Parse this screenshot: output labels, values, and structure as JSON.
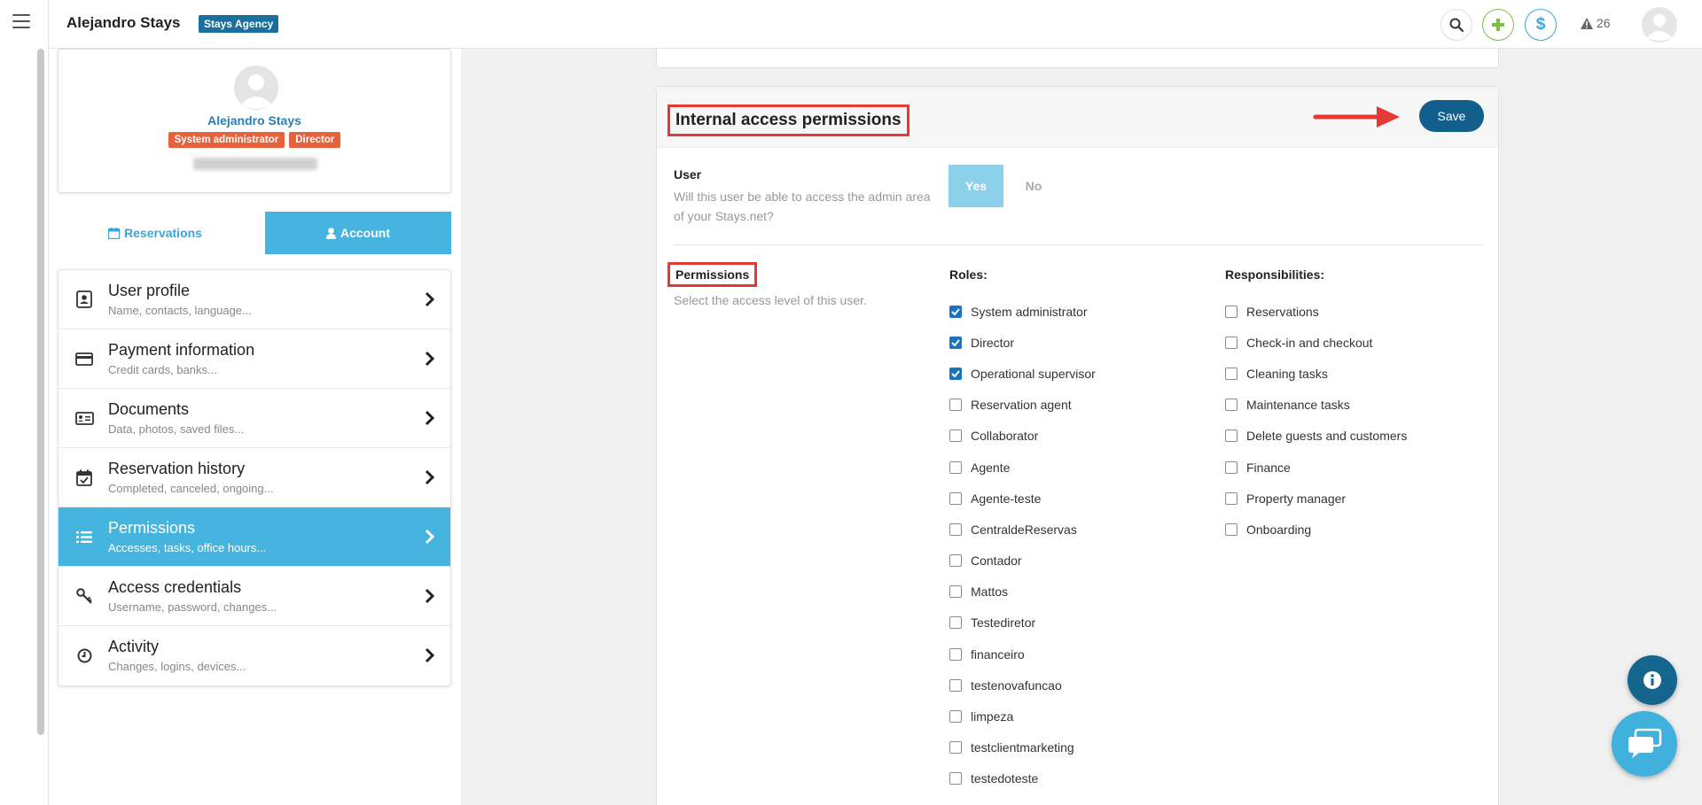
{
  "topbar": {
    "brand": "Alejandro Stays",
    "agency_badge": "Stays Agency",
    "alert_count": "26"
  },
  "profile": {
    "name": "Alejandro Stays",
    "badges": [
      "System administrator",
      "Director"
    ]
  },
  "tabs": {
    "reservations": "Reservations",
    "account": "Account"
  },
  "menu": [
    {
      "title": "User profile",
      "subtitle": "Name, contacts, language...",
      "icon": "contact-card-icon"
    },
    {
      "title": "Payment information",
      "subtitle": "Credit cards, banks...",
      "icon": "credit-card-icon"
    },
    {
      "title": "Documents",
      "subtitle": "Data, photos, saved files...",
      "icon": "id-card-icon"
    },
    {
      "title": "Reservation history",
      "subtitle": "Completed, canceled, ongoing...",
      "icon": "calendar-check-icon"
    },
    {
      "title": "Permissions",
      "subtitle": "Accesses, tasks, office hours...",
      "icon": "list-icon"
    },
    {
      "title": "Access credentials",
      "subtitle": "Username, password, changes...",
      "icon": "key-icon"
    },
    {
      "title": "Activity",
      "subtitle": "Changes, logins, devices...",
      "icon": "clock-icon"
    }
  ],
  "card": {
    "title": "Internal access permissions",
    "save_label": "Save",
    "user_label": "User",
    "user_desc": "Will this user be able to access the admin area of your Stays.net?",
    "yes_label": "Yes",
    "no_label": "No",
    "permissions_label": "Permissions",
    "permissions_desc": "Select the access level of this user.",
    "roles_head": "Roles:",
    "responsibilities_head": "Responsibilities:"
  },
  "roles": [
    {
      "label": "System administrator",
      "checked": true
    },
    {
      "label": "Director",
      "checked": true
    },
    {
      "label": "Operational supervisor",
      "checked": true
    },
    {
      "label": "Reservation agent",
      "checked": false
    },
    {
      "label": "Collaborator",
      "checked": false
    },
    {
      "label": "Agente",
      "checked": false
    },
    {
      "label": "Agente-teste",
      "checked": false
    },
    {
      "label": "CentraldeReservas",
      "checked": false
    },
    {
      "label": "Contador",
      "checked": false
    },
    {
      "label": "Mattos",
      "checked": false
    },
    {
      "label": "Testediretor",
      "checked": false
    },
    {
      "label": "financeiro",
      "checked": false
    },
    {
      "label": "testenovafuncao",
      "checked": false
    },
    {
      "label": "limpeza",
      "checked": false
    },
    {
      "label": "testclientmarketing",
      "checked": false
    },
    {
      "label": "testedoteste",
      "checked": false
    }
  ],
  "responsibilities": [
    {
      "label": "Reservations",
      "checked": false
    },
    {
      "label": "Check-in and checkout",
      "checked": false
    },
    {
      "label": "Cleaning tasks",
      "checked": false
    },
    {
      "label": "Maintenance tasks",
      "checked": false
    },
    {
      "label": "Delete guests and customers",
      "checked": false
    },
    {
      "label": "Finance",
      "checked": false
    },
    {
      "label": "Property manager",
      "checked": false
    },
    {
      "label": "Onboarding",
      "checked": false
    }
  ],
  "colors": {
    "accent": "#45b4de",
    "primary": "#125f8c",
    "badge": "#e8603c",
    "highlight": "#e53935"
  }
}
